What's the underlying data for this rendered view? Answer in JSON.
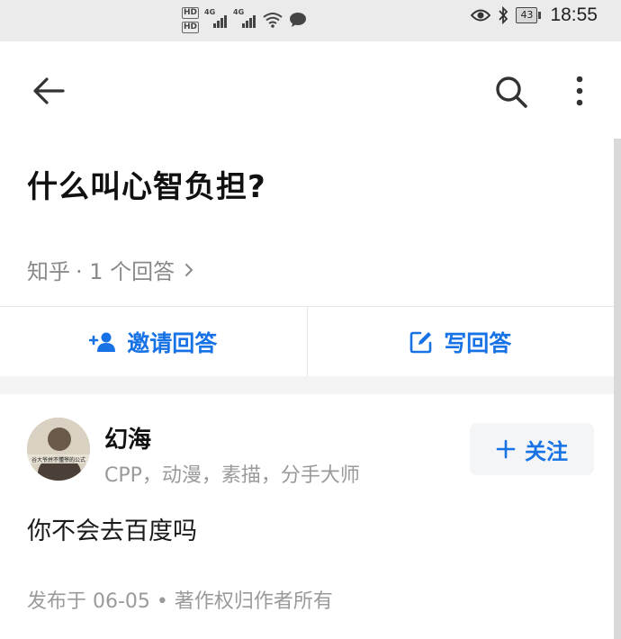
{
  "status_bar": {
    "hd1": "HD",
    "hd2": "HD",
    "net1": "4G",
    "net2": "4G",
    "battery": "43",
    "time": "18:55"
  },
  "toolbar": {
    "back_icon": "arrow-left-icon",
    "search_icon": "search-icon",
    "more_icon": "more-vertical-icon"
  },
  "question": {
    "title": "什么叫心智负担?",
    "source": "知乎",
    "answer_count": "· 1 个回答"
  },
  "actions": {
    "invite_label": "邀请回答",
    "write_label": "写回答"
  },
  "answer": {
    "author_name": "幻海",
    "author_tags": "CPP，动漫，素描，分手大师",
    "follow_label": "关注",
    "avatar_caption": "谷大爷并不懂爷的公式",
    "content": "你不会去百度吗",
    "footer": "发布于 06-05 • 著作权归作者所有"
  },
  "colors": {
    "accent": "#1772e6",
    "muted": "#9a9a9a",
    "statusbar_bg": "#ebebeb"
  }
}
